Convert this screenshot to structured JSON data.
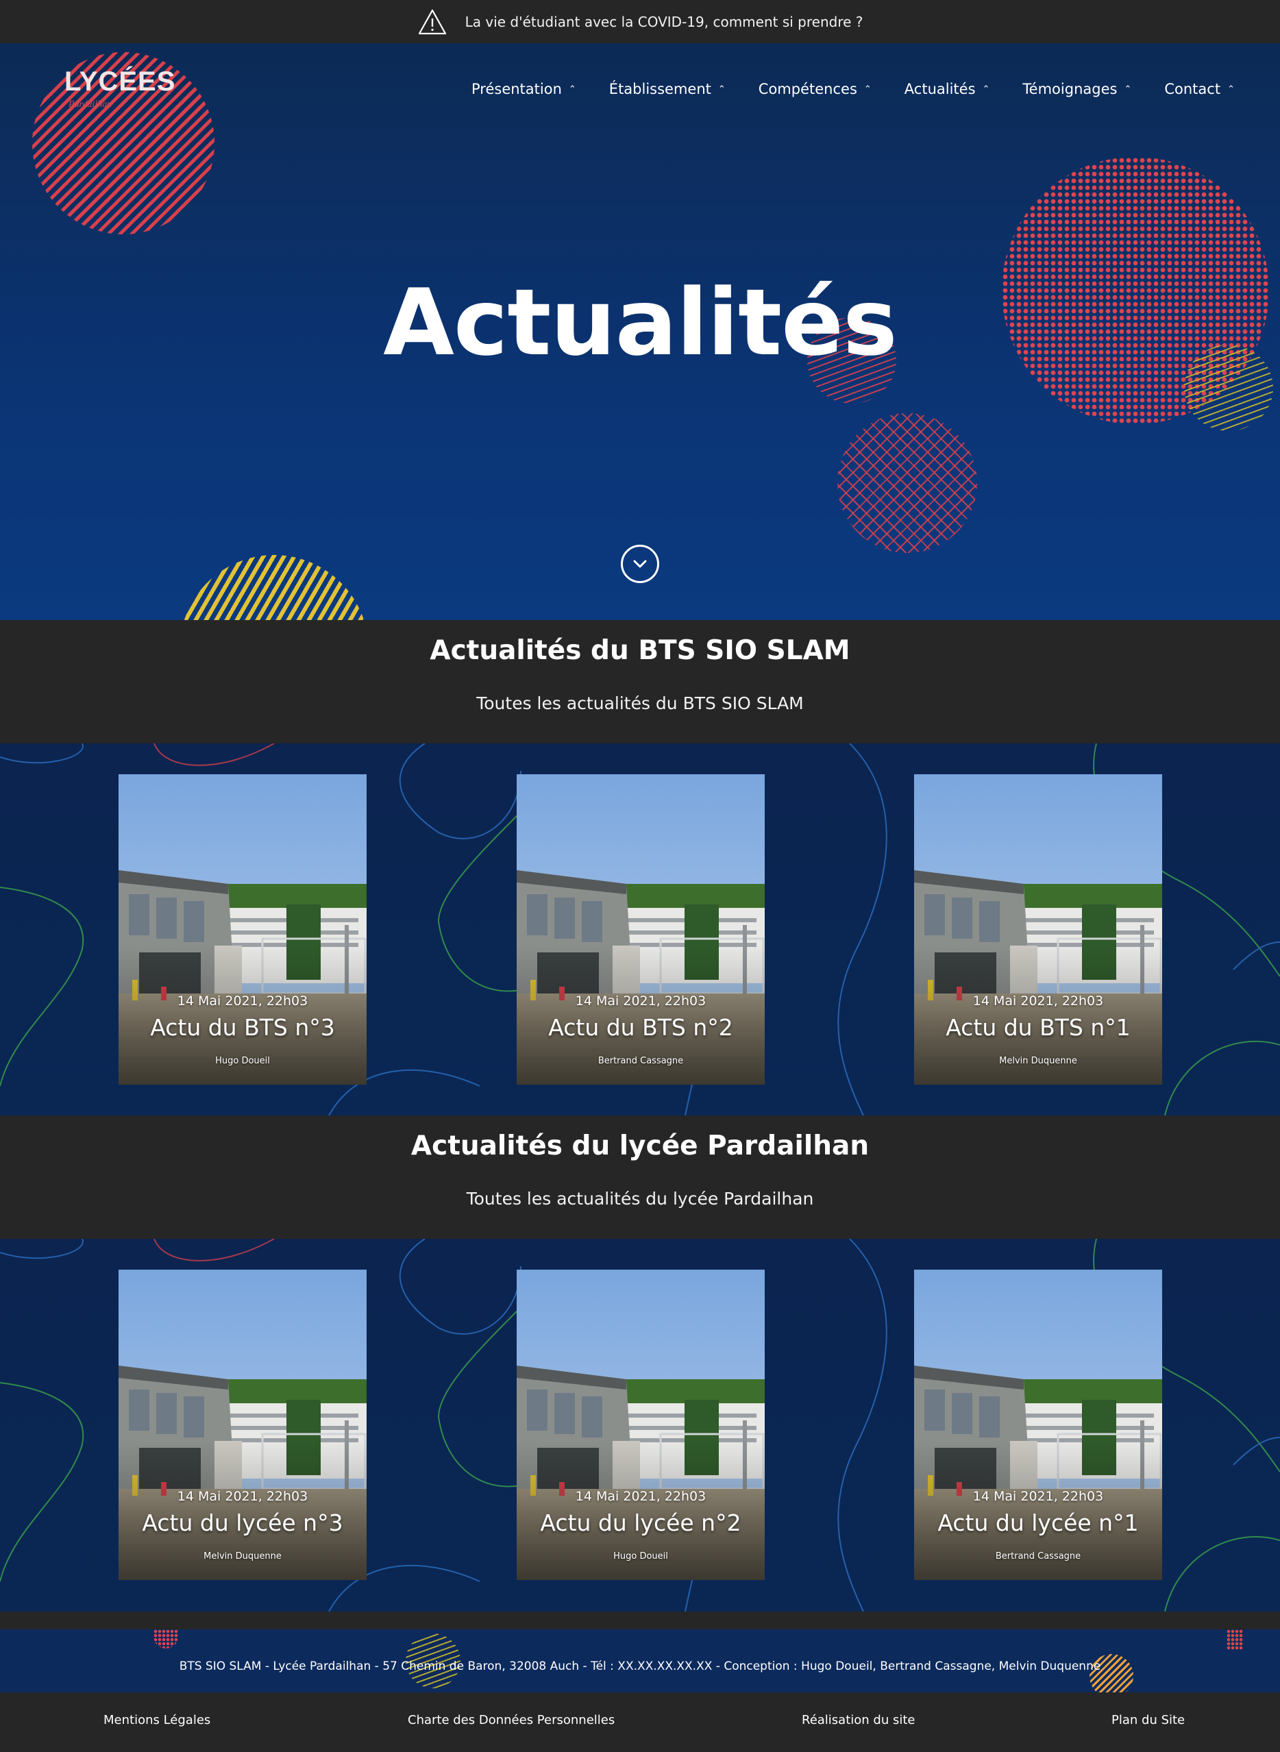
{
  "topbar": {
    "icon": "warning-triangle-icon",
    "text": "La vie d'étudiant avec la COVID-19, comment si prendre ?"
  },
  "header": {
    "logo_text": "LYCÉES",
    "logo_sub": "Pardailhan",
    "nav": [
      {
        "label": "Présentation"
      },
      {
        "label": "Établissement"
      },
      {
        "label": "Compétences"
      },
      {
        "label": "Actualités"
      },
      {
        "label": "Témoignages"
      },
      {
        "label": "Contact"
      }
    ]
  },
  "hero": {
    "title": "Actualités",
    "scroll_icon": "chevron-down-icon"
  },
  "section_bts": {
    "heading": "Actualités du BTS SIO SLAM",
    "subtitle": "Toutes les actualités du BTS SIO SLAM",
    "cards": [
      {
        "date": "14 Mai 2021, 22h03",
        "title": "Actu du BTS n°3",
        "author": "Hugo Doueil"
      },
      {
        "date": "14 Mai 2021, 22h03",
        "title": "Actu du BTS n°2",
        "author": "Bertrand Cassagne"
      },
      {
        "date": "14 Mai 2021, 22h03",
        "title": "Actu du BTS n°1",
        "author": "Melvin Duquenne"
      }
    ]
  },
  "section_lycee": {
    "heading": "Actualités du lycée Pardailhan",
    "subtitle": "Toutes les actualités du lycée Pardailhan",
    "cards": [
      {
        "date": "14 Mai 2021, 22h03",
        "title": "Actu du lycée n°3",
        "author": "Melvin Duquenne"
      },
      {
        "date": "14 Mai 2021, 22h03",
        "title": "Actu du lycée n°2",
        "author": "Hugo Doueil"
      },
      {
        "date": "14 Mai 2021, 22h03",
        "title": "Actu du lycée n°1",
        "author": "Bertrand Cassagne"
      }
    ]
  },
  "footer": {
    "info": "BTS SIO SLAM - Lycée Pardailhan - 57 Chemin de Baron, 32008 Auch - Tél : XX.XX.XX.XX.XX - Conception : Hugo Doueil, Bertrand Cassagne, Melvin Duquenne",
    "links": [
      {
        "label": "Mentions Légales"
      },
      {
        "label": "Charte des Données Personnelles"
      },
      {
        "label": "Réalisation du site"
      },
      {
        "label": "Plan du Site"
      }
    ]
  },
  "colors": {
    "navy": "#0b3474",
    "dark": "#262626",
    "accent_red": "#d9404b",
    "accent_yellow": "#e2c233"
  }
}
